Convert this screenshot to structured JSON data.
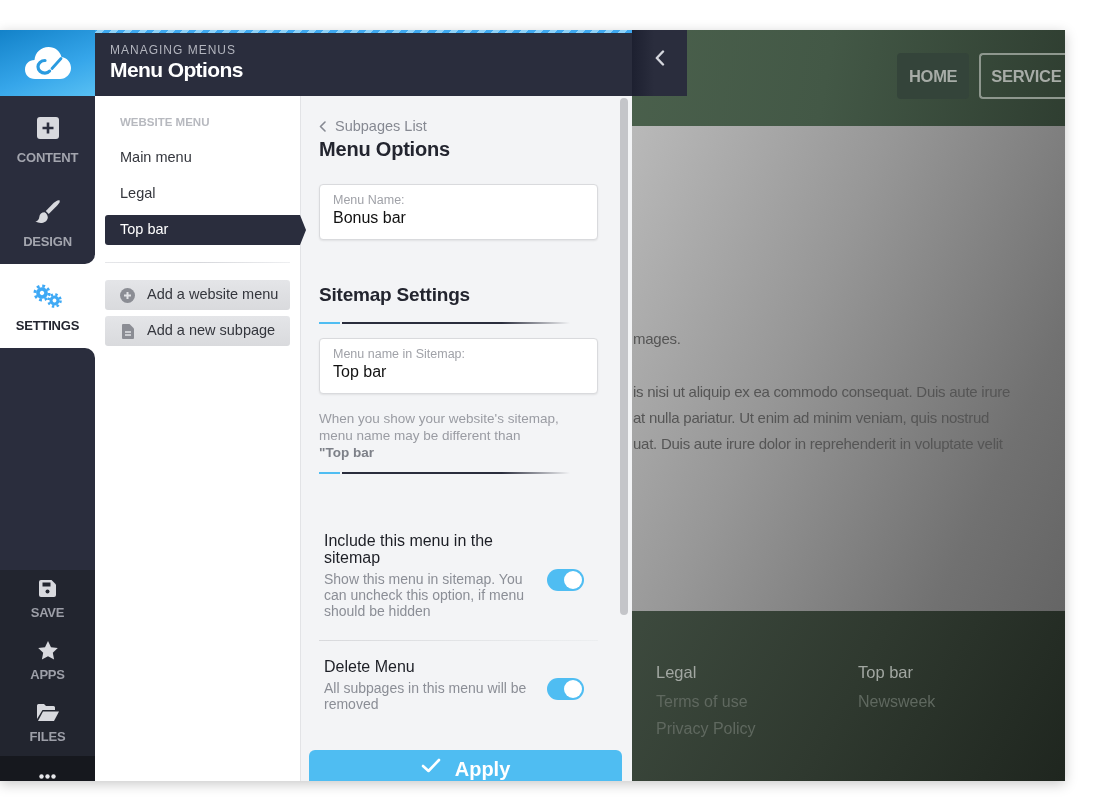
{
  "sidebar": {
    "items": [
      {
        "label": "CONTENT",
        "selected": false
      },
      {
        "label": "DESIGN",
        "selected": false
      },
      {
        "label": "SETTINGS",
        "selected": true
      }
    ],
    "tools": [
      {
        "label": "SAVE"
      },
      {
        "label": "APPS"
      },
      {
        "label": "FILES"
      }
    ]
  },
  "header": {
    "eyebrow": "MANAGING MENUS",
    "title": "Menu Options"
  },
  "menu_list": {
    "heading": "WEBSITE MENU",
    "items": [
      {
        "label": "Main menu",
        "selected": false
      },
      {
        "label": "Legal",
        "selected": false
      },
      {
        "label": "Top bar",
        "selected": true
      }
    ],
    "actions": [
      {
        "label": "Add a website menu"
      },
      {
        "label": "Add a new subpage"
      }
    ]
  },
  "settings": {
    "back_link": "Subpages List",
    "title": "Menu Options",
    "name_field": {
      "label": "Menu Name:",
      "value": "Bonus bar"
    },
    "sitemap_title": "Sitemap Settings",
    "sitemap_field": {
      "label": "Menu name in Sitemap:",
      "value": "Top bar"
    },
    "sitemap_help": "When you show your website's sitemap, menu name may be different than **\"Top bar**",
    "options": [
      {
        "title": "Include this menu in the sitemap",
        "description": "Show this menu in sitemap. You can uncheck this option, if menu should be hidden",
        "on": true
      },
      {
        "title": "Delete Menu",
        "description": "All subpages in this menu will be removed",
        "on": true
      }
    ],
    "apply_button": "Apply"
  },
  "preview": {
    "nav": [
      {
        "label": "HOME",
        "selected": true
      },
      {
        "label": "SERVICE",
        "selected": false
      }
    ],
    "body_lines": [
      "mages.",
      "is nisi ut aliquip ex ea commodo consequat. Duis aute irure",
      "at nulla pariatur. Ut enim ad minim veniam, quis nostrud",
      "uat. Duis aute irure dolor in reprehenderit in voluptate velit"
    ],
    "footer_columns": [
      {
        "heading": "Legal",
        "links": [
          "Terms of use",
          "Privacy Policy"
        ]
      },
      {
        "heading": "Top bar",
        "links": [
          "Newsweek"
        ]
      }
    ]
  }
}
